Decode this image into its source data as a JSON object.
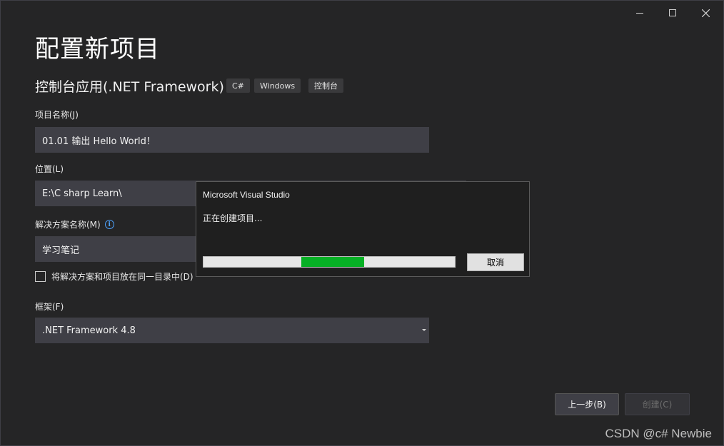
{
  "window": {
    "title": "配置新项目",
    "controls": {
      "minimize_icon": "minimize-icon",
      "maximize_icon": "maximize-icon",
      "close_icon": "close-icon"
    }
  },
  "project_type": {
    "name": "控制台应用(.NET Framework)",
    "tags": [
      "C#",
      "Windows",
      "控制台"
    ]
  },
  "form": {
    "project_name": {
      "label": "项目名称(J)",
      "value": "01.01 输出 Hello World！"
    },
    "location": {
      "label": "位置(L)",
      "value": "E:\\C sharp Learn\\"
    },
    "solution_name": {
      "label": "解决方案名称(M)",
      "value": "学习笔记",
      "info_icon": "info-icon"
    },
    "same_directory": {
      "label": "将解决方案和项目放在同一目录中(D)",
      "checked": false
    },
    "framework": {
      "label": "框架(F)",
      "value": ".NET Framework 4.8"
    }
  },
  "buttons": {
    "back": "上一步(B)",
    "create": "创建(C)"
  },
  "dialog": {
    "title": "Microsoft Visual Studio",
    "message": "正在创建项目...",
    "cancel": "取消",
    "progress": {
      "fill_start": 0.39,
      "fill_end": 0.64
    }
  },
  "watermark": "CSDN @c# Newbie",
  "colors": {
    "background": "#252526",
    "field": "#3f3f46",
    "progress_fill": "#06b025",
    "info_accent": "#4ea3ff"
  }
}
